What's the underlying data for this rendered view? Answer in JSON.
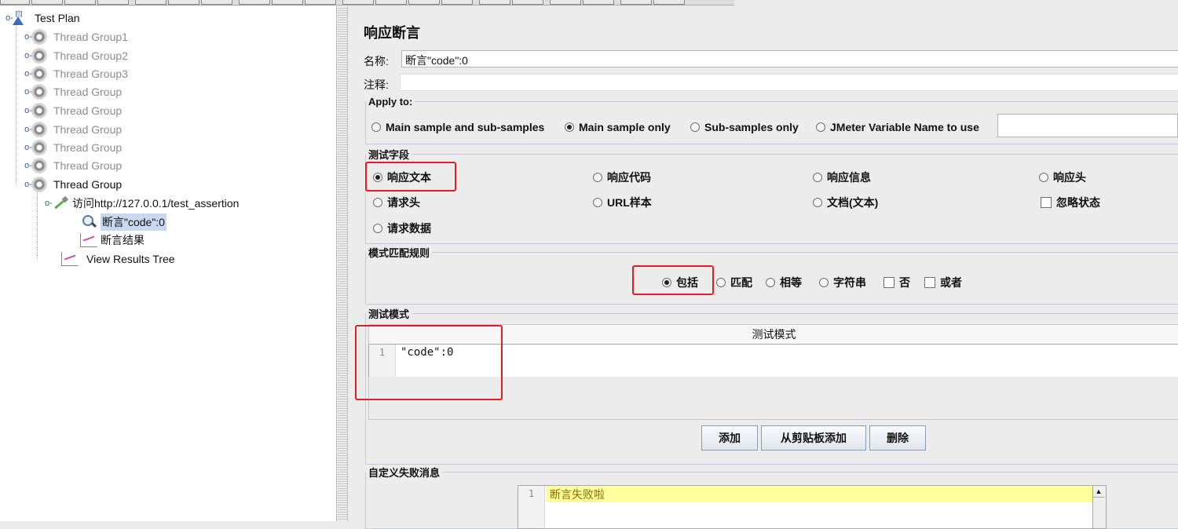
{
  "tree": {
    "root": "Test Plan",
    "groups": [
      "Thread Group1",
      "Thread Group2",
      "Thread Group3",
      "Thread Group",
      "Thread Group",
      "Thread Group",
      "Thread Group",
      "Thread Group"
    ],
    "active_group": "Thread Group",
    "sampler": "访问http://127.0.0.1/test_assertion",
    "assertion": "断言\"code\":0",
    "listener_child": "断言结果",
    "results_tree": "View Results Tree"
  },
  "panel": {
    "title": "响应断言",
    "name_label": "名称:",
    "name_value": "断言\"code\":0",
    "comment_label": "注释:",
    "comment_value": ""
  },
  "apply_to": {
    "legend": "Apply to:",
    "options": [
      "Main sample and sub-samples",
      "Main sample only",
      "Sub-samples only",
      "JMeter Variable Name to use"
    ],
    "selected": "Main sample only",
    "variable_value": ""
  },
  "test_field": {
    "legend": "测试字段",
    "options": [
      "响应文本",
      "响应代码",
      "响应信息",
      "响应头",
      "请求头",
      "URL样本",
      "文档(文本)",
      "忽略状态",
      "请求数据"
    ],
    "selected": "响应文本",
    "ignore_status_checked": false
  },
  "match_rules": {
    "legend": "模式匹配规则",
    "options": [
      "包括",
      "匹配",
      "相等",
      "字符串",
      "否",
      "或者"
    ],
    "selected": "包括"
  },
  "patterns": {
    "legend": "测试模式",
    "column_header": "测试模式",
    "line_number": "1",
    "value": "\"code\":0"
  },
  "buttons": {
    "add": "添加",
    "add_clipboard": "从剪贴板添加",
    "delete": "删除"
  },
  "failure_message": {
    "legend": "自定义失败消息",
    "line_number": "1",
    "value": "断言失败啦"
  },
  "colors": {
    "highlight_red": "#e02020",
    "selection_blue": "#c8d8ee",
    "message_yellow": "#ffffa0"
  },
  "icons": {
    "root": "flask-icon",
    "group": "gear-icon",
    "sampler": "pipette-icon",
    "assertion": "magnifier-icon",
    "listener": "graph-icon"
  }
}
